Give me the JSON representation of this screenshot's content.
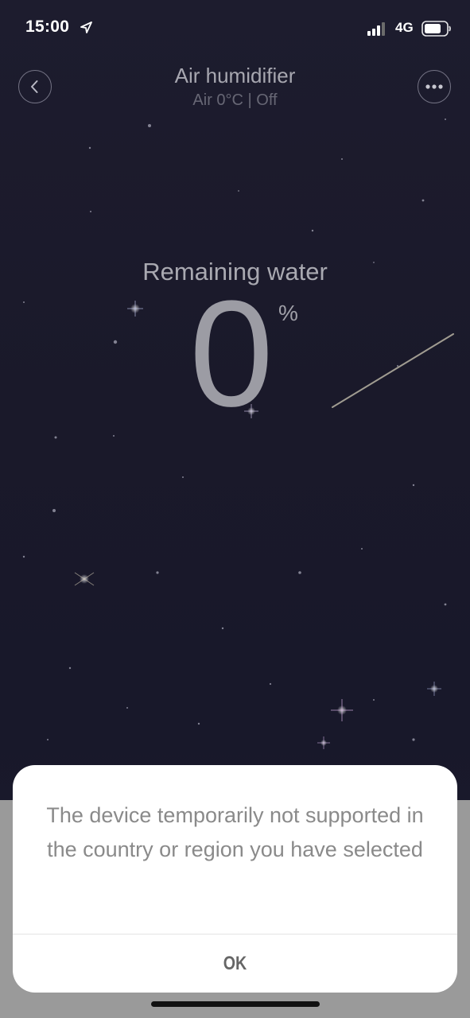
{
  "status_bar": {
    "time": "15:00",
    "network": "4G",
    "location_icon": "location-arrow-icon",
    "signal_icon": "signal-bars-icon",
    "battery_icon": "battery-icon"
  },
  "header": {
    "title": "Air humidifier",
    "subtitle": "Air 0°C | Off",
    "back_icon": "chevron-left-icon",
    "more_icon": "more-dots-icon"
  },
  "reading": {
    "label": "Remaining water",
    "value": "0",
    "unit": "%"
  },
  "dialog": {
    "message": "The device temporarily not supported in the country or region you have selected",
    "ok_label": "OK"
  },
  "colors": {
    "background": "#1b1a2b",
    "dialog_background": "#ffffff",
    "overlay": "#9a9a9a"
  }
}
